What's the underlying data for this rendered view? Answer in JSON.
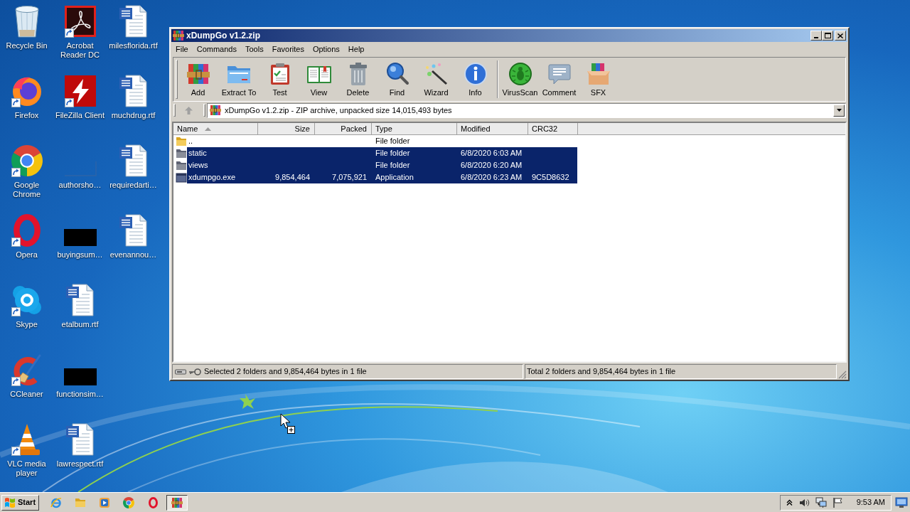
{
  "desktop_icons": [
    {
      "label": "Recycle Bin",
      "kind": "recycle-bin",
      "shortcut": false
    },
    {
      "label": "Firefox",
      "kind": "firefox",
      "shortcut": true
    },
    {
      "label": "Google Chrome",
      "kind": "chrome",
      "shortcut": true
    },
    {
      "label": "Opera",
      "kind": "opera",
      "shortcut": true
    },
    {
      "label": "Skype",
      "kind": "skype",
      "shortcut": true
    },
    {
      "label": "CCleaner",
      "kind": "ccleaner",
      "shortcut": true
    },
    {
      "label": "VLC media player",
      "kind": "vlc",
      "shortcut": true
    },
    {
      "label": "Acrobat Reader DC",
      "kind": "acrobat",
      "shortcut": true
    },
    {
      "label": "FileZilla Client",
      "kind": "filezilla",
      "shortcut": true
    },
    {
      "label": "authorsho…",
      "kind": "blank",
      "shortcut": false
    },
    {
      "label": "buyingsum…",
      "kind": "black",
      "shortcut": false
    },
    {
      "label": "etalbum.rtf",
      "kind": "word",
      "shortcut": false
    },
    {
      "label": "functionsim…",
      "kind": "black",
      "shortcut": false
    },
    {
      "label": "lawrespect.rtf",
      "kind": "word",
      "shortcut": false
    },
    {
      "label": "milesflorida.rtf",
      "kind": "word",
      "shortcut": false
    },
    {
      "label": "muchdrug.rtf",
      "kind": "word",
      "shortcut": false
    },
    {
      "label": "requiredarti…",
      "kind": "word",
      "shortcut": false
    },
    {
      "label": "evenannou…",
      "kind": "word",
      "shortcut": false
    }
  ],
  "window": {
    "title": "xDumpGo v1.2.zip",
    "menu": [
      "File",
      "Commands",
      "Tools",
      "Favorites",
      "Options",
      "Help"
    ],
    "toolbar": [
      {
        "label": "Add",
        "kind": "add"
      },
      {
        "label": "Extract To",
        "kind": "extract-to"
      },
      {
        "label": "Test",
        "kind": "test"
      },
      {
        "label": "View",
        "kind": "view"
      },
      {
        "label": "Delete",
        "kind": "delete"
      },
      {
        "label": "Find",
        "kind": "find"
      },
      {
        "label": "Wizard",
        "kind": "wizard"
      },
      {
        "label": "Info",
        "kind": "info"
      },
      {
        "kind": "separator"
      },
      {
        "label": "VirusScan",
        "kind": "virus-scan"
      },
      {
        "label": "Comment",
        "kind": "comment"
      },
      {
        "label": "SFX",
        "kind": "sfx"
      }
    ],
    "up_disabled": true,
    "address": "xDumpGo v1.2.zip - ZIP archive, unpacked size 14,015,493 bytes",
    "columns": [
      {
        "label": "Name",
        "kind": "text",
        "sorted": true
      },
      {
        "label": "Size",
        "kind": "number",
        "sorted": false
      },
      {
        "label": "Packed",
        "kind": "number",
        "sorted": false
      },
      {
        "label": "Type",
        "kind": "text",
        "sorted": false
      },
      {
        "label": "Modified",
        "kind": "text",
        "sorted": false
      },
      {
        "label": "CRC32",
        "kind": "text",
        "sorted": false
      }
    ],
    "rows": [
      {
        "kind": "folder",
        "name": "..",
        "type": "File folder",
        "selected": false
      },
      {
        "kind": "folder",
        "name": "static",
        "type": "File folder",
        "modified": "6/8/2020 6:03 AM",
        "selected": true
      },
      {
        "kind": "folder",
        "name": "views",
        "type": "File folder",
        "modified": "6/8/2020 6:20 AM",
        "selected": true
      },
      {
        "kind": "application",
        "name": "xdumpgo.exe",
        "size": "9,854,464",
        "packed": "7,075,921",
        "type": "Application",
        "modified": "6/8/2020 6:23 AM",
        "crc32": "9C5D8632",
        "selected": true
      }
    ],
    "status_bar": {
      "selection": "Selected 2 folders and 9,854,464 bytes in 1 file",
      "total": "Total 2 folders and 9,854,464 bytes in 1 file"
    }
  },
  "taskbar": {
    "start": "Start",
    "buttons": [
      {
        "kind": "ie",
        "active": false
      },
      {
        "kind": "explorer",
        "active": false
      },
      {
        "kind": "media-player",
        "active": false
      },
      {
        "kind": "chrome",
        "active": false
      },
      {
        "kind": "opera",
        "active": false
      },
      {
        "kind": "winrar",
        "active": true
      }
    ],
    "clock": "9:53 AM"
  }
}
